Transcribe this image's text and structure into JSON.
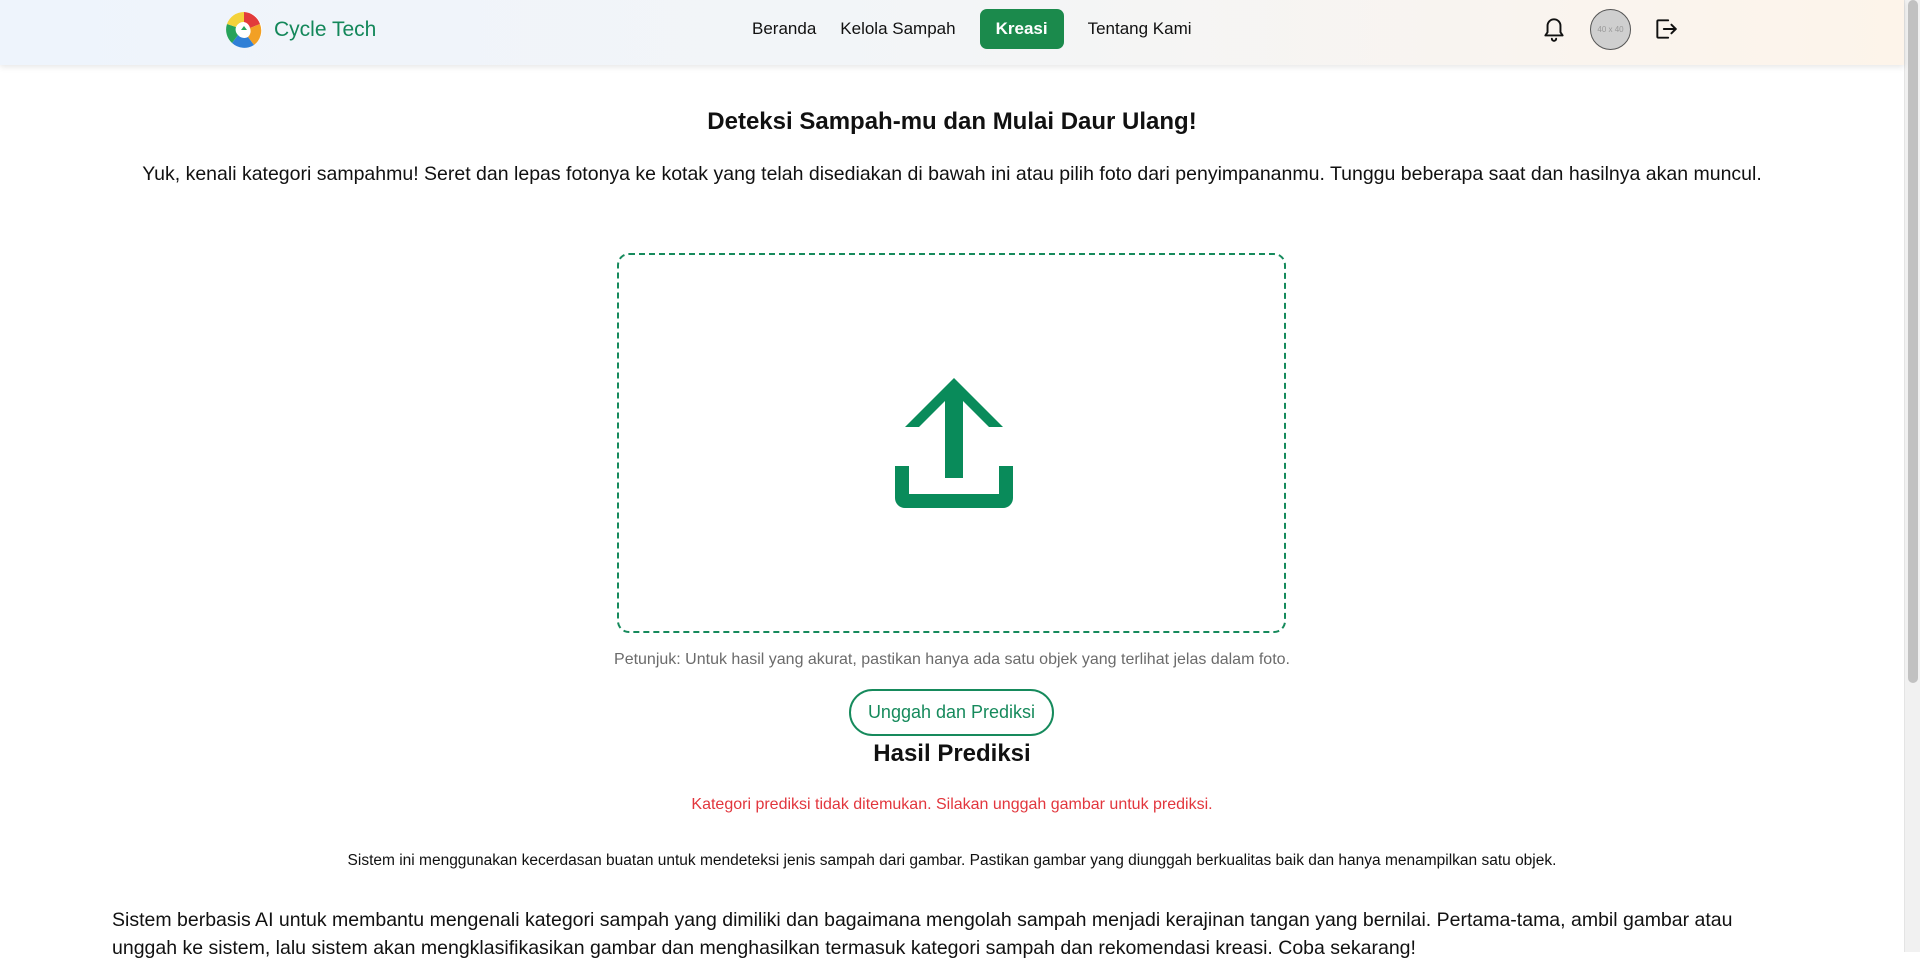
{
  "brand": {
    "name": "Cycle Tech"
  },
  "nav": {
    "items": [
      {
        "label": "Beranda",
        "active": false
      },
      {
        "label": "Kelola Sampah",
        "active": false
      },
      {
        "label": "Kreasi",
        "active": true
      },
      {
        "label": "Tentang Kami",
        "active": false
      }
    ]
  },
  "header_icons": {
    "notification": "bell-icon",
    "avatar_placeholder": "40 x 40",
    "logout": "logout-icon"
  },
  "main": {
    "title": "Deteksi Sampah-mu dan Mulai Daur Ulang!",
    "intro": "Yuk, kenali kategori sampahmu! Seret dan lepas fotonya ke kotak yang telah disediakan di bawah ini atau pilih foto dari penyimpananmu. Tunggu beberapa saat dan hasilnya akan muncul.",
    "dropzone_icon": "upload-icon",
    "hint": "Petunjuk: Untuk hasil yang akurat, pastikan hanya ada satu objek yang terlihat jelas dalam foto.",
    "upload_button": "Unggah dan Prediksi",
    "result_title": "Hasil Prediksi",
    "result_error": "Kategori prediksi tidak ditemukan. Silakan unggah gambar untuk prediksi.",
    "info_small": "Sistem ini menggunakan kecerdasan buatan untuk mendeteksi jenis sampah dari gambar. Pastikan gambar yang diunggah berkualitas baik dan hanya menampilkan satu objek.",
    "info_large": "Sistem berbasis AI untuk membantu mengenali kategori sampah yang dimiliki dan bagaimana mengolah sampah menjadi kerajinan tangan yang bernilai. Pertama-tama, ambil gambar atau unggah ke sistem, lalu sistem akan mengklasifikasikan gambar dan menghasilkan termasuk kategori sampah dan rekomendasi kreasi. Coba sekarang!"
  },
  "colors": {
    "brand_green": "#14875a",
    "active_nav": "#1b8a4c",
    "error_red": "#e2363d"
  }
}
